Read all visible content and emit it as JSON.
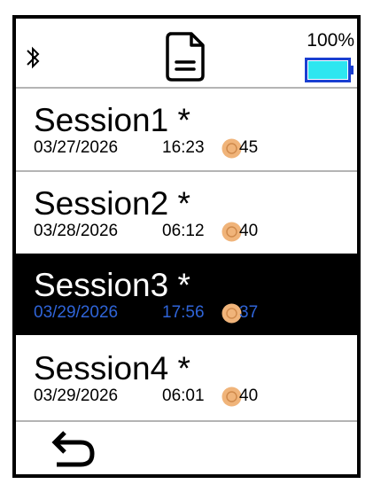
{
  "status_bar": {
    "bluetooth_icon": "bluetooth-icon",
    "document_icon": "document-icon",
    "battery_percent": "100%",
    "battery_icon": "battery-icon",
    "battery_fill_fraction": 1.0,
    "battery_color": "#2ee6f0"
  },
  "sessions": [
    {
      "name": "Session1 *",
      "date": "03/27/2026",
      "time": "16:23",
      "duration": "45",
      "selected": false
    },
    {
      "name": "Session2 *",
      "date": "03/28/2026",
      "time": "06:12",
      "duration": "40",
      "selected": false
    },
    {
      "name": "Session3 *",
      "date": "03/29/2026",
      "time": "17:56",
      "duration": "37",
      "selected": true
    },
    {
      "name": "Session4 *",
      "date": "03/29/2026",
      "time": "06:01",
      "duration": "40",
      "selected": false
    }
  ],
  "colors": {
    "selected_background": "#000000",
    "selected_name": "#ffffff",
    "selected_detail": "#2f64d8",
    "duration_icon": "#f0b47a"
  },
  "footer": {
    "back_icon": "back-arrow-icon"
  }
}
